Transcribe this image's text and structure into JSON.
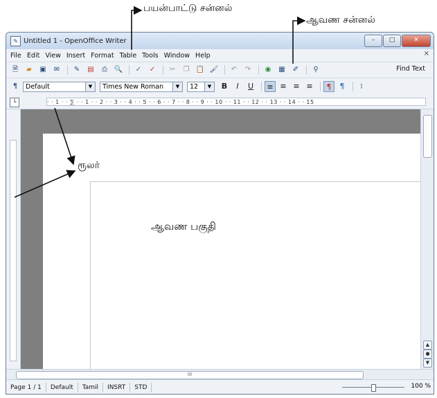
{
  "annotations": {
    "title_window": "பயன்பாட்டு சன்னல்",
    "document_window": "ஆவண சன்னல்",
    "ruler": "ரூலர்",
    "document_area": "ஆவண பகுதி"
  },
  "window": {
    "title": "Untitled 1 - OpenOffice Writer",
    "controls": {
      "minimize": "–",
      "maximize": "□",
      "close": "✕"
    }
  },
  "menu": {
    "items": [
      "File",
      "Edit",
      "View",
      "Insert",
      "Format",
      "Table",
      "Tools",
      "Window",
      "Help"
    ],
    "close": "×"
  },
  "toolbar": {
    "find_text": "Find Text"
  },
  "format": {
    "style": "Default",
    "font": "Times New Roman",
    "size": "12",
    "bold": "B",
    "italic": "I",
    "underline": "U"
  },
  "ruler": {
    "marks": "· · 1 · · ⅀ · · 1 · · 2 · · 3 · · 4 · · 5 · · 6 · · 7 · · 8 · · 9 · · 10 · · 11 · · 12 · · 13 · · 14 · · 15"
  },
  "hscroll": {
    "grip": "III"
  },
  "status": {
    "page": "Page 1 / 1",
    "style": "Default",
    "language": "Tamil",
    "insert_mode": "INSRT",
    "selection_mode": "STD",
    "zoom": "100 %"
  }
}
